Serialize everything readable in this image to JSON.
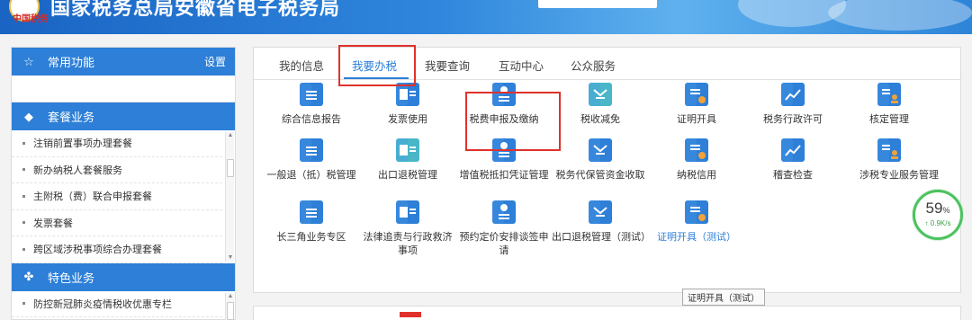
{
  "header": {
    "title": "国家税务总局安徽省电子税务局",
    "logo_text": "中国税务"
  },
  "sidebar": {
    "common": {
      "icon": "star-outline-icon",
      "title": "常用功能",
      "settings": "设置"
    },
    "package": {
      "icon": "diamond-icon",
      "title": "套餐业务"
    },
    "package_items": [
      "注销前置事项办理套餐",
      "新办纳税人套餐服务",
      "主附税（费）联合申报套餐",
      "发票套餐",
      "跨区域涉税事项综合办理套餐"
    ],
    "special": {
      "icon": "grid-icon",
      "title": "特色业务"
    },
    "special_items": [
      "防控新冠肺炎疫情税收优惠专栏"
    ]
  },
  "tabs": [
    "我的信息",
    "我要办税",
    "我要查询",
    "互动中心",
    "公众服务"
  ],
  "active_tab": "我要办税",
  "functions": [
    {
      "label": "综合信息报告",
      "icon": "document-upload-icon"
    },
    {
      "label": "发票使用",
      "icon": "invoice-icon"
    },
    {
      "label": "税费申报及缴纳",
      "icon": "tax-declaration-icon"
    },
    {
      "label": "税收减免",
      "icon": "tax-exemption-icon"
    },
    {
      "label": "证明开具",
      "icon": "certificate-icon"
    },
    {
      "label": "税务行政许可",
      "icon": "license-chart-icon"
    },
    {
      "label": "核定管理",
      "icon": "assessment-icon"
    },
    {
      "label": "一般退（抵）税管理",
      "icon": "refund-icon"
    },
    {
      "label": "出口退税管理",
      "icon": "export-refund-icon"
    },
    {
      "label": "增值税抵扣凭证管理",
      "icon": "vat-voucher-icon"
    },
    {
      "label": "税务代保管资金收取",
      "icon": "custody-funds-icon"
    },
    {
      "label": "纳税信用",
      "icon": "credit-icon"
    },
    {
      "label": "稽查检查",
      "icon": "inspection-icon"
    },
    {
      "label": "涉税专业服务管理",
      "icon": "professional-service-icon"
    },
    {
      "label": "长三角业务专区",
      "icon": "yangtze-delta-icon"
    },
    {
      "label": "法律追责与行政救济事项",
      "icon": "legal-remedy-icon"
    },
    {
      "label": "预约定价安排谈签申请",
      "icon": "pricing-agreement-icon"
    },
    {
      "label": "出口退税管理（测试）",
      "icon": "export-refund-test-icon"
    },
    {
      "label": "证明开具（测试）",
      "icon": "certificate-test-icon"
    }
  ],
  "tooltip": "证明开具（测试）",
  "network": {
    "percent": "59",
    "percent_unit": "%",
    "rate": "↑ 0.9K/s"
  },
  "colors": {
    "primary": "#2d7fd7",
    "highlight": "#e0322b",
    "success": "#4bc25e"
  }
}
